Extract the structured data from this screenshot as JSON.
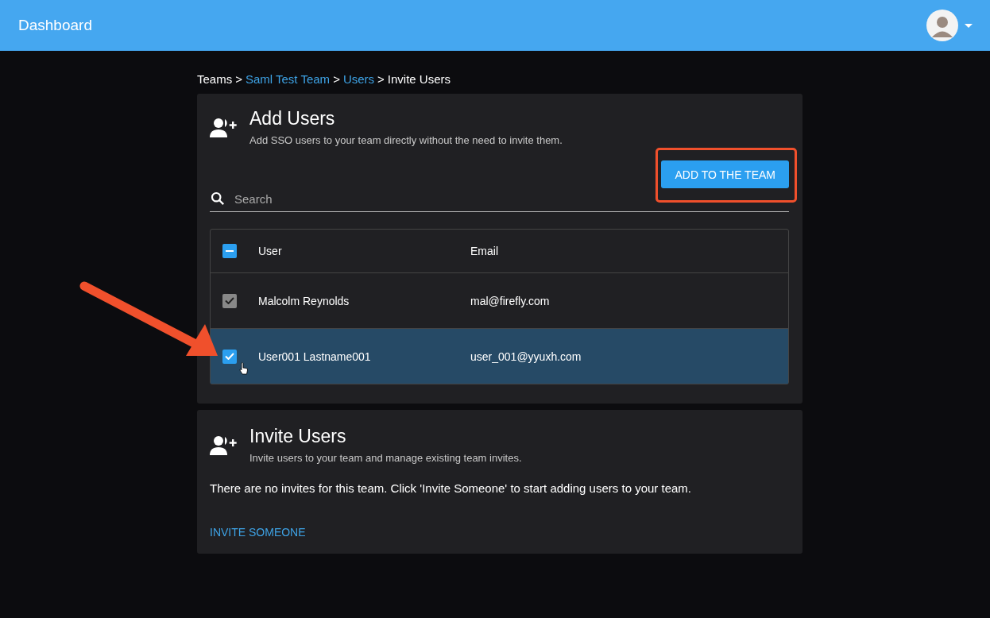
{
  "app_bar": {
    "title": "Dashboard"
  },
  "breadcrumb": {
    "separator": ">",
    "items": [
      {
        "label": "Teams",
        "link": false
      },
      {
        "label": "Saml Test Team",
        "link": true
      },
      {
        "label": "Users",
        "link": true
      },
      {
        "label": "Invite Users",
        "link": false
      }
    ]
  },
  "add_users": {
    "title": "Add Users",
    "subtitle": "Add SSO users to your team directly without the need to invite them.",
    "button": {
      "label": "ADD TO THE TEAM",
      "highlighted": true
    },
    "search": {
      "placeholder": "Search"
    },
    "table": {
      "select_all": {
        "checked": true,
        "indeterminate": true
      },
      "columns": [
        "User",
        "Email"
      ],
      "rows": [
        {
          "name": "Malcolm Reynolds",
          "email": "mal@firefly.com",
          "checked": true,
          "disabled": true,
          "selected": false,
          "pointed": false
        },
        {
          "name": "User001 Lastname001",
          "email": "user_001@yyuxh.com",
          "checked": true,
          "disabled": false,
          "selected": true,
          "pointed": true
        }
      ]
    }
  },
  "invite_users": {
    "title": "Invite Users",
    "subtitle": "Invite users to your team and manage existing team invites.",
    "message": "There are no invites for this team. Click 'Invite Someone' to start adding users to your team.",
    "link": "INVITE SOMEONE"
  }
}
